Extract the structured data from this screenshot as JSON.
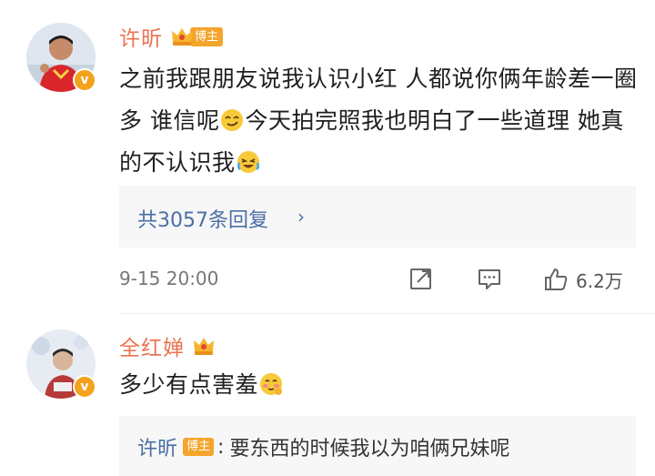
{
  "comments": [
    {
      "user": "许昕",
      "tag": "博主",
      "text_parts": [
        "之前我跟朋友说我认识小红 人都说你俩年龄差一圈多 谁信呢",
        "今天拍完照我也明白了一些道理 她真的不认识我"
      ],
      "emojis": [
        "smirk-emoji",
        "laugh-cry-emoji"
      ],
      "reply_count_label": "共3057条回复",
      "time": "9-15 20:00",
      "likes": "6.2万"
    },
    {
      "user": "全红婵",
      "text": "多少有点害羞",
      "emoji": "shy-emoji",
      "sub_reply": {
        "user": "许昕",
        "tag": "博主",
        "colon": ":",
        "text": "要东西的时候我以为咱俩兄妹呢"
      }
    }
  ],
  "icons": {
    "verified": "v",
    "chevron": "›"
  },
  "colors": {
    "username": "#eb7350",
    "link": "#4a6fa5",
    "badge": "#f4a52b",
    "reply_bg": "#f7f7f7"
  }
}
